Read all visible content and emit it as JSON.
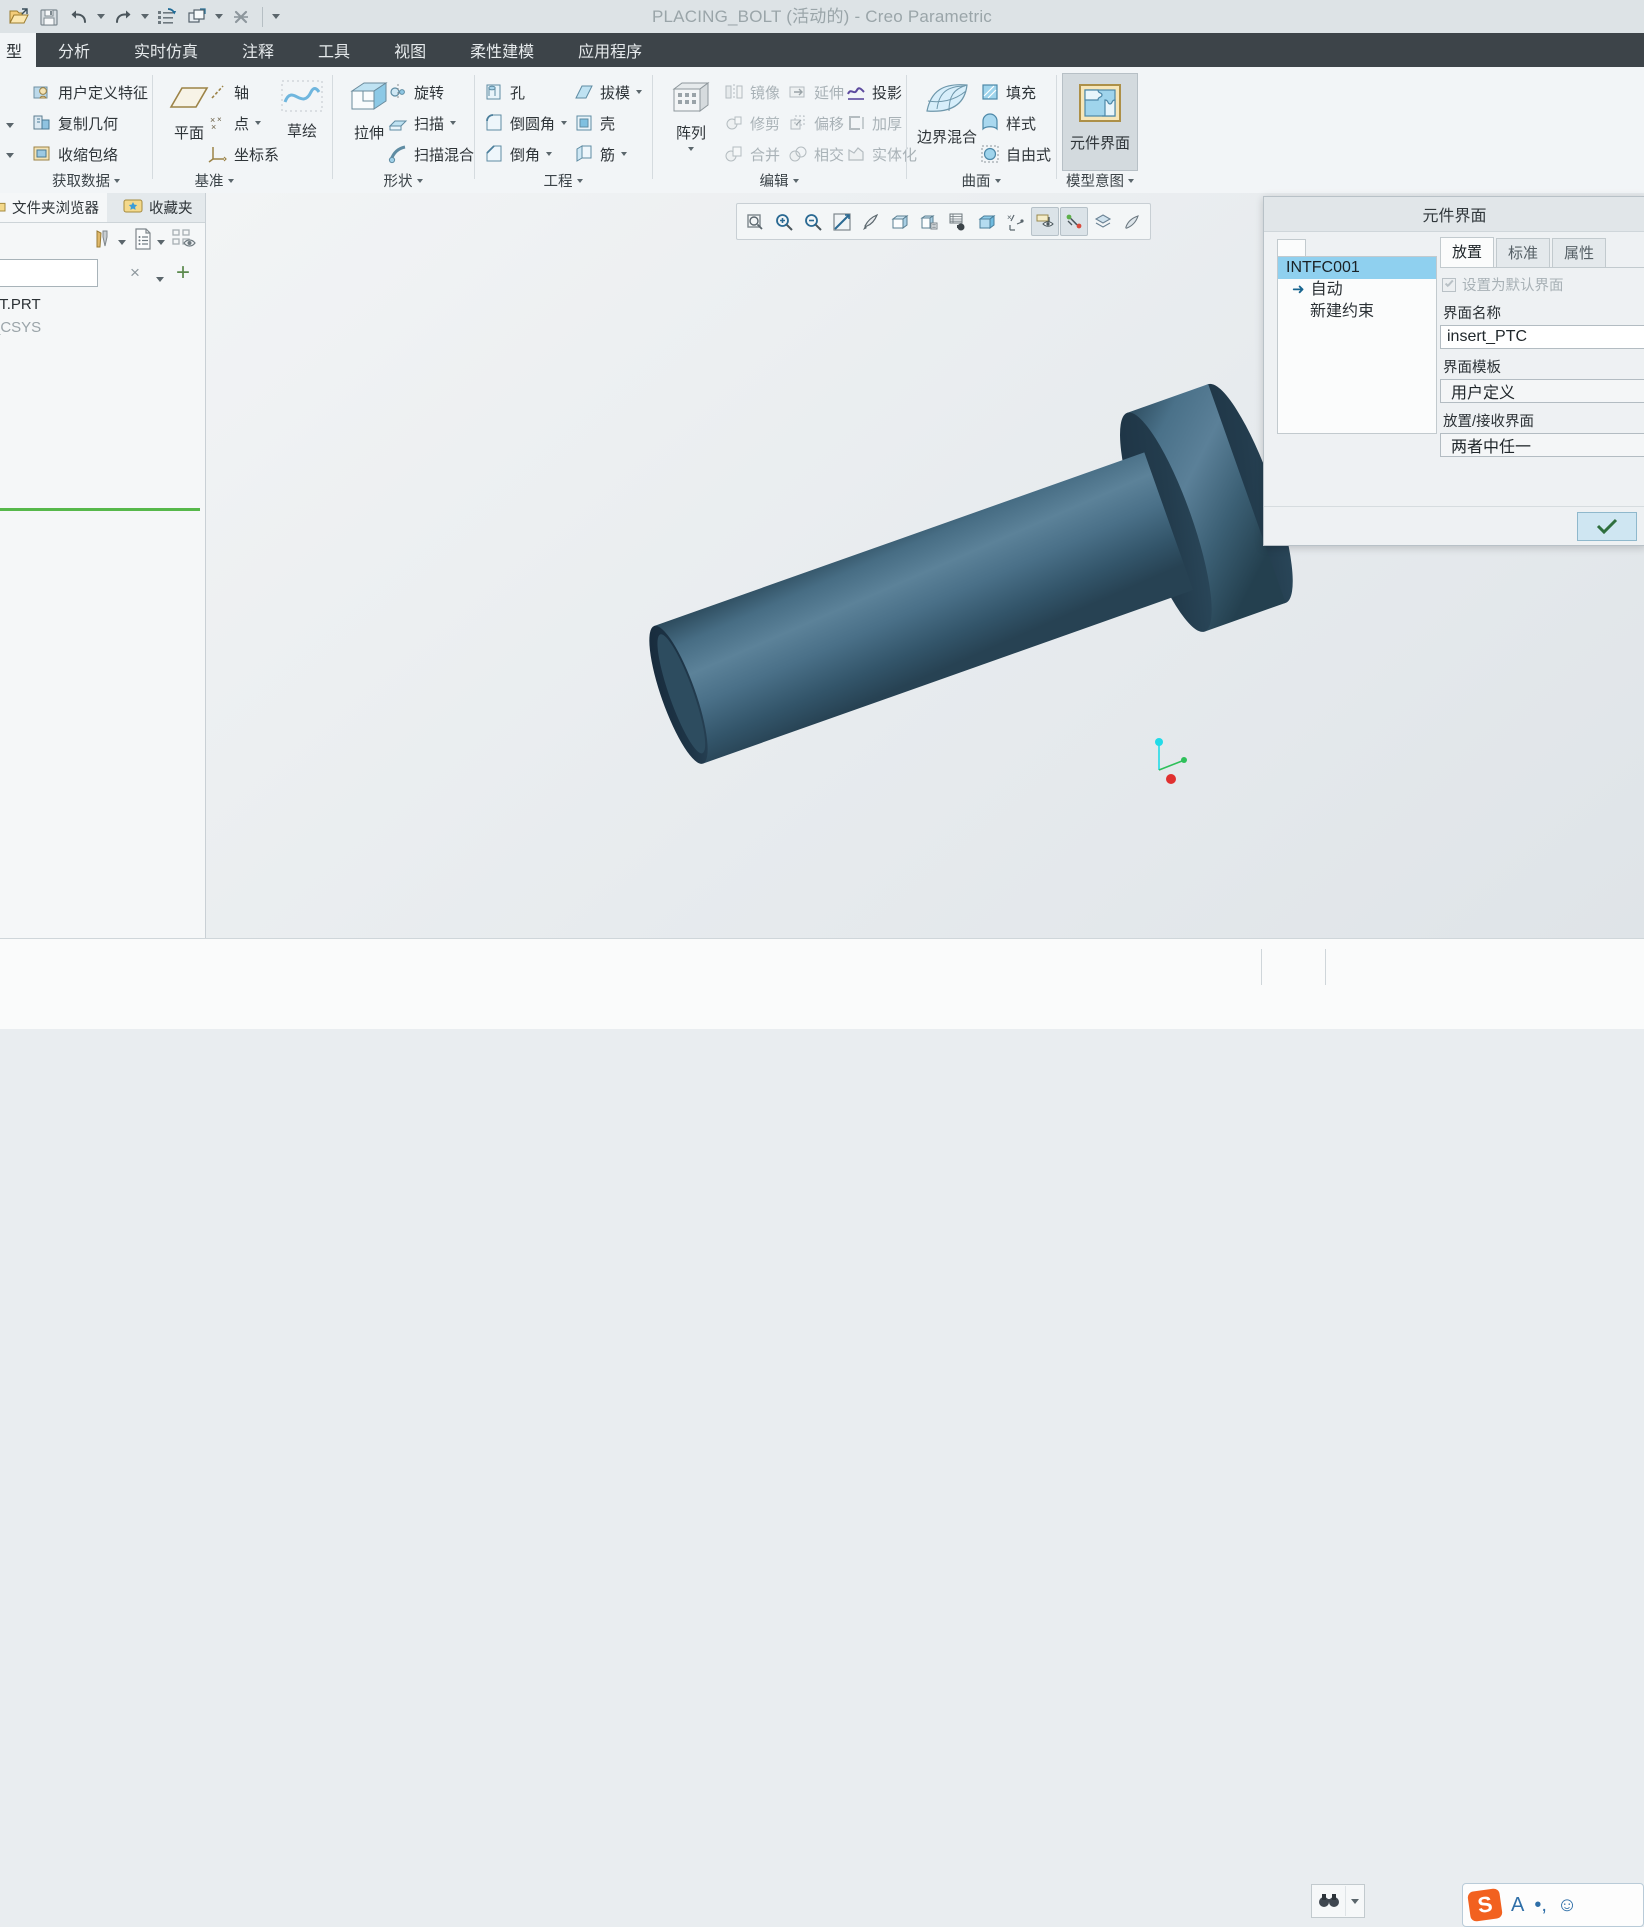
{
  "window": {
    "title": "PLACING_BOLT (活动的) - Creo Parametric"
  },
  "quick_access": {
    "items": [
      {
        "name": "open-icon",
        "label": "打开"
      },
      {
        "name": "save-icon",
        "label": "保存"
      },
      {
        "name": "undo-icon",
        "label": "撤消"
      },
      {
        "name": "undo-dropdown-icon",
        "label": "撤消选项"
      },
      {
        "name": "redo-icon",
        "label": "重做"
      },
      {
        "name": "redo-dropdown-icon",
        "label": "重做选项"
      },
      {
        "name": "regenerate-icon",
        "label": "重新生成"
      },
      {
        "name": "window-icon",
        "label": "窗口"
      },
      {
        "name": "window-dropdown-icon",
        "label": "窗口选项"
      },
      {
        "name": "close-window-icon",
        "label": "关闭"
      },
      {
        "name": "customize-qat-icon",
        "label": "自定义快速访问工具栏"
      }
    ]
  },
  "ribbon": {
    "tabs": [
      {
        "label": "型",
        "active": true
      },
      {
        "label": "分析",
        "active": false
      },
      {
        "label": "实时仿真",
        "active": false
      },
      {
        "label": "注释",
        "active": false
      },
      {
        "label": "工具",
        "active": false
      },
      {
        "label": "视图",
        "active": false
      },
      {
        "label": "柔性建模",
        "active": false
      },
      {
        "label": "应用程序",
        "active": false
      }
    ],
    "groups": [
      {
        "label": "获取数据",
        "items": [
          {
            "label": "用户定义特征",
            "disabled": false
          },
          {
            "label": "复制几何",
            "disabled": false
          },
          {
            "label": "收缩包络",
            "disabled": false
          }
        ]
      },
      {
        "label": "基准",
        "big": {
          "label": "平面"
        },
        "items": [
          {
            "label": "轴",
            "disabled": false,
            "dropdown": false
          },
          {
            "label": "点",
            "disabled": false,
            "dropdown": true
          },
          {
            "label": "坐标系",
            "disabled": false,
            "dropdown": false
          }
        ]
      },
      {
        "label": "形状",
        "big": {
          "label": "拉伸"
        },
        "items": [
          {
            "label": "旋转",
            "disabled": false,
            "dropdown": false
          },
          {
            "label": "扫描",
            "disabled": false,
            "dropdown": true
          },
          {
            "label": "扫描混合",
            "disabled": false,
            "dropdown": false
          }
        ]
      },
      {
        "label": "工程",
        "col1": [
          {
            "label": "孔",
            "disabled": false,
            "dropdown": false
          },
          {
            "label": "倒圆角",
            "disabled": false,
            "dropdown": true
          },
          {
            "label": "倒角",
            "disabled": false,
            "dropdown": true
          }
        ],
        "col2": [
          {
            "label": "拔模",
            "disabled": false,
            "dropdown": true
          },
          {
            "label": "壳",
            "disabled": false,
            "dropdown": false
          },
          {
            "label": "筋",
            "disabled": false,
            "dropdown": true
          }
        ]
      },
      {
        "label": "编辑",
        "big": {
          "label": "阵列",
          "dropdown": true
        },
        "col1": [
          {
            "label": "镜像",
            "disabled": true
          },
          {
            "label": "修剪",
            "disabled": true
          },
          {
            "label": "合并",
            "disabled": true
          }
        ],
        "col2": [
          {
            "label": "延伸",
            "disabled": true
          },
          {
            "label": "偏移",
            "disabled": true
          },
          {
            "label": "相交",
            "disabled": true
          }
        ],
        "col3": [
          {
            "label": "投影",
            "disabled": false
          },
          {
            "label": "加厚",
            "disabled": true
          },
          {
            "label": "实体化",
            "disabled": true
          }
        ]
      },
      {
        "label": "曲面",
        "big": {
          "label": "边界混合"
        },
        "items": [
          {
            "label": "填充",
            "disabled": false
          },
          {
            "label": "样式",
            "disabled": false
          },
          {
            "label": "自由式",
            "disabled": false
          }
        ]
      },
      {
        "label": "模型意图",
        "big": {
          "label": "元件界面",
          "active": true
        }
      }
    ]
  },
  "left_panel": {
    "tabs": [
      {
        "label": "文件夹浏览器",
        "icon": "folder-browser-icon",
        "selected": true
      },
      {
        "label": "收藏夹",
        "icon": "favorites-icon",
        "selected": false
      }
    ],
    "toolbar_icons": [
      {
        "name": "tools-icon"
      },
      {
        "name": "tools-dropdown-icon"
      },
      {
        "name": "list-icon"
      },
      {
        "name": "list-dropdown-icon"
      },
      {
        "name": "hide-tree-icon"
      }
    ],
    "search": {
      "value": "",
      "clear_label": "×",
      "dropdown_label": "▾",
      "add_label": "+"
    },
    "tree": [
      {
        "label": "LT.PRT",
        "dim": false
      },
      {
        "label": "_CSYS",
        "dim": true
      }
    ]
  },
  "graphics_toolbar": {
    "buttons": [
      {
        "name": "zoom-box-icon",
        "label": "放大区域",
        "active": false
      },
      {
        "name": "zoom-in-icon",
        "label": "放大",
        "active": false
      },
      {
        "name": "zoom-out-icon",
        "label": "缩小",
        "active": false
      },
      {
        "name": "refit-icon",
        "label": "重新调整",
        "active": false
      },
      {
        "name": "repaint-icon",
        "label": "重画",
        "active": false
      },
      {
        "name": "display-style-icon",
        "label": "显示样式",
        "active": false
      },
      {
        "name": "saved-orientations-icon",
        "label": "已保存方向",
        "active": false
      },
      {
        "name": "view-manager-icon",
        "label": "视图管理器",
        "active": false
      },
      {
        "name": "perspective-icon",
        "label": "透视图",
        "active": false
      },
      {
        "name": "datum-display-icon",
        "label": "基准显示过滤器",
        "active": false
      },
      {
        "name": "annotation-display-icon",
        "label": "注释显示",
        "active": true
      },
      {
        "name": "spin-center-icon",
        "label": "旋转中心",
        "active": true
      },
      {
        "name": "layer-icon",
        "label": "层",
        "active": false
      },
      {
        "name": "appearance-icon",
        "label": "外观",
        "active": false
      }
    ]
  },
  "dialog": {
    "title": "元件界面",
    "tree": {
      "selected": "INTFC001",
      "children": [
        {
          "label": "自动",
          "icon": "arrow-right-icon"
        },
        {
          "label": "新建约束",
          "icon": ""
        }
      ]
    },
    "tabs": [
      {
        "label": "放置",
        "selected": true
      },
      {
        "label": "标准",
        "selected": false
      },
      {
        "label": "属性",
        "selected": false
      }
    ],
    "checkbox": {
      "label": "设置为默认界面",
      "checked": true,
      "disabled": true
    },
    "fields": [
      {
        "label": "界面名称",
        "value": "insert_PTC",
        "type": "text"
      },
      {
        "label": "界面模板",
        "value": "用户定义",
        "type": "combo"
      },
      {
        "label": "放置/接收界面",
        "value": "两者中任一",
        "type": "combo"
      }
    ],
    "footer": {
      "ok_label": "✓"
    }
  },
  "bottom_bar": {
    "find_button": {
      "name": "find-icon",
      "label": "查找"
    },
    "ime": {
      "logo": "S",
      "items": [
        {
          "name": "ime-mode-icon",
          "label": "A"
        },
        {
          "name": "ime-punct-icon",
          "label": "•,"
        },
        {
          "name": "ime-emoji-icon",
          "label": "☺"
        }
      ]
    }
  },
  "model": {
    "name": "PLACING_BOLT",
    "body_color": "#3f6074",
    "body_highlight": "#5b8098",
    "body_shadow": "#22394a",
    "csys": {
      "x_color": "#e03030",
      "y_color": "#2ec05a",
      "z_color": "#22dbe8"
    }
  }
}
